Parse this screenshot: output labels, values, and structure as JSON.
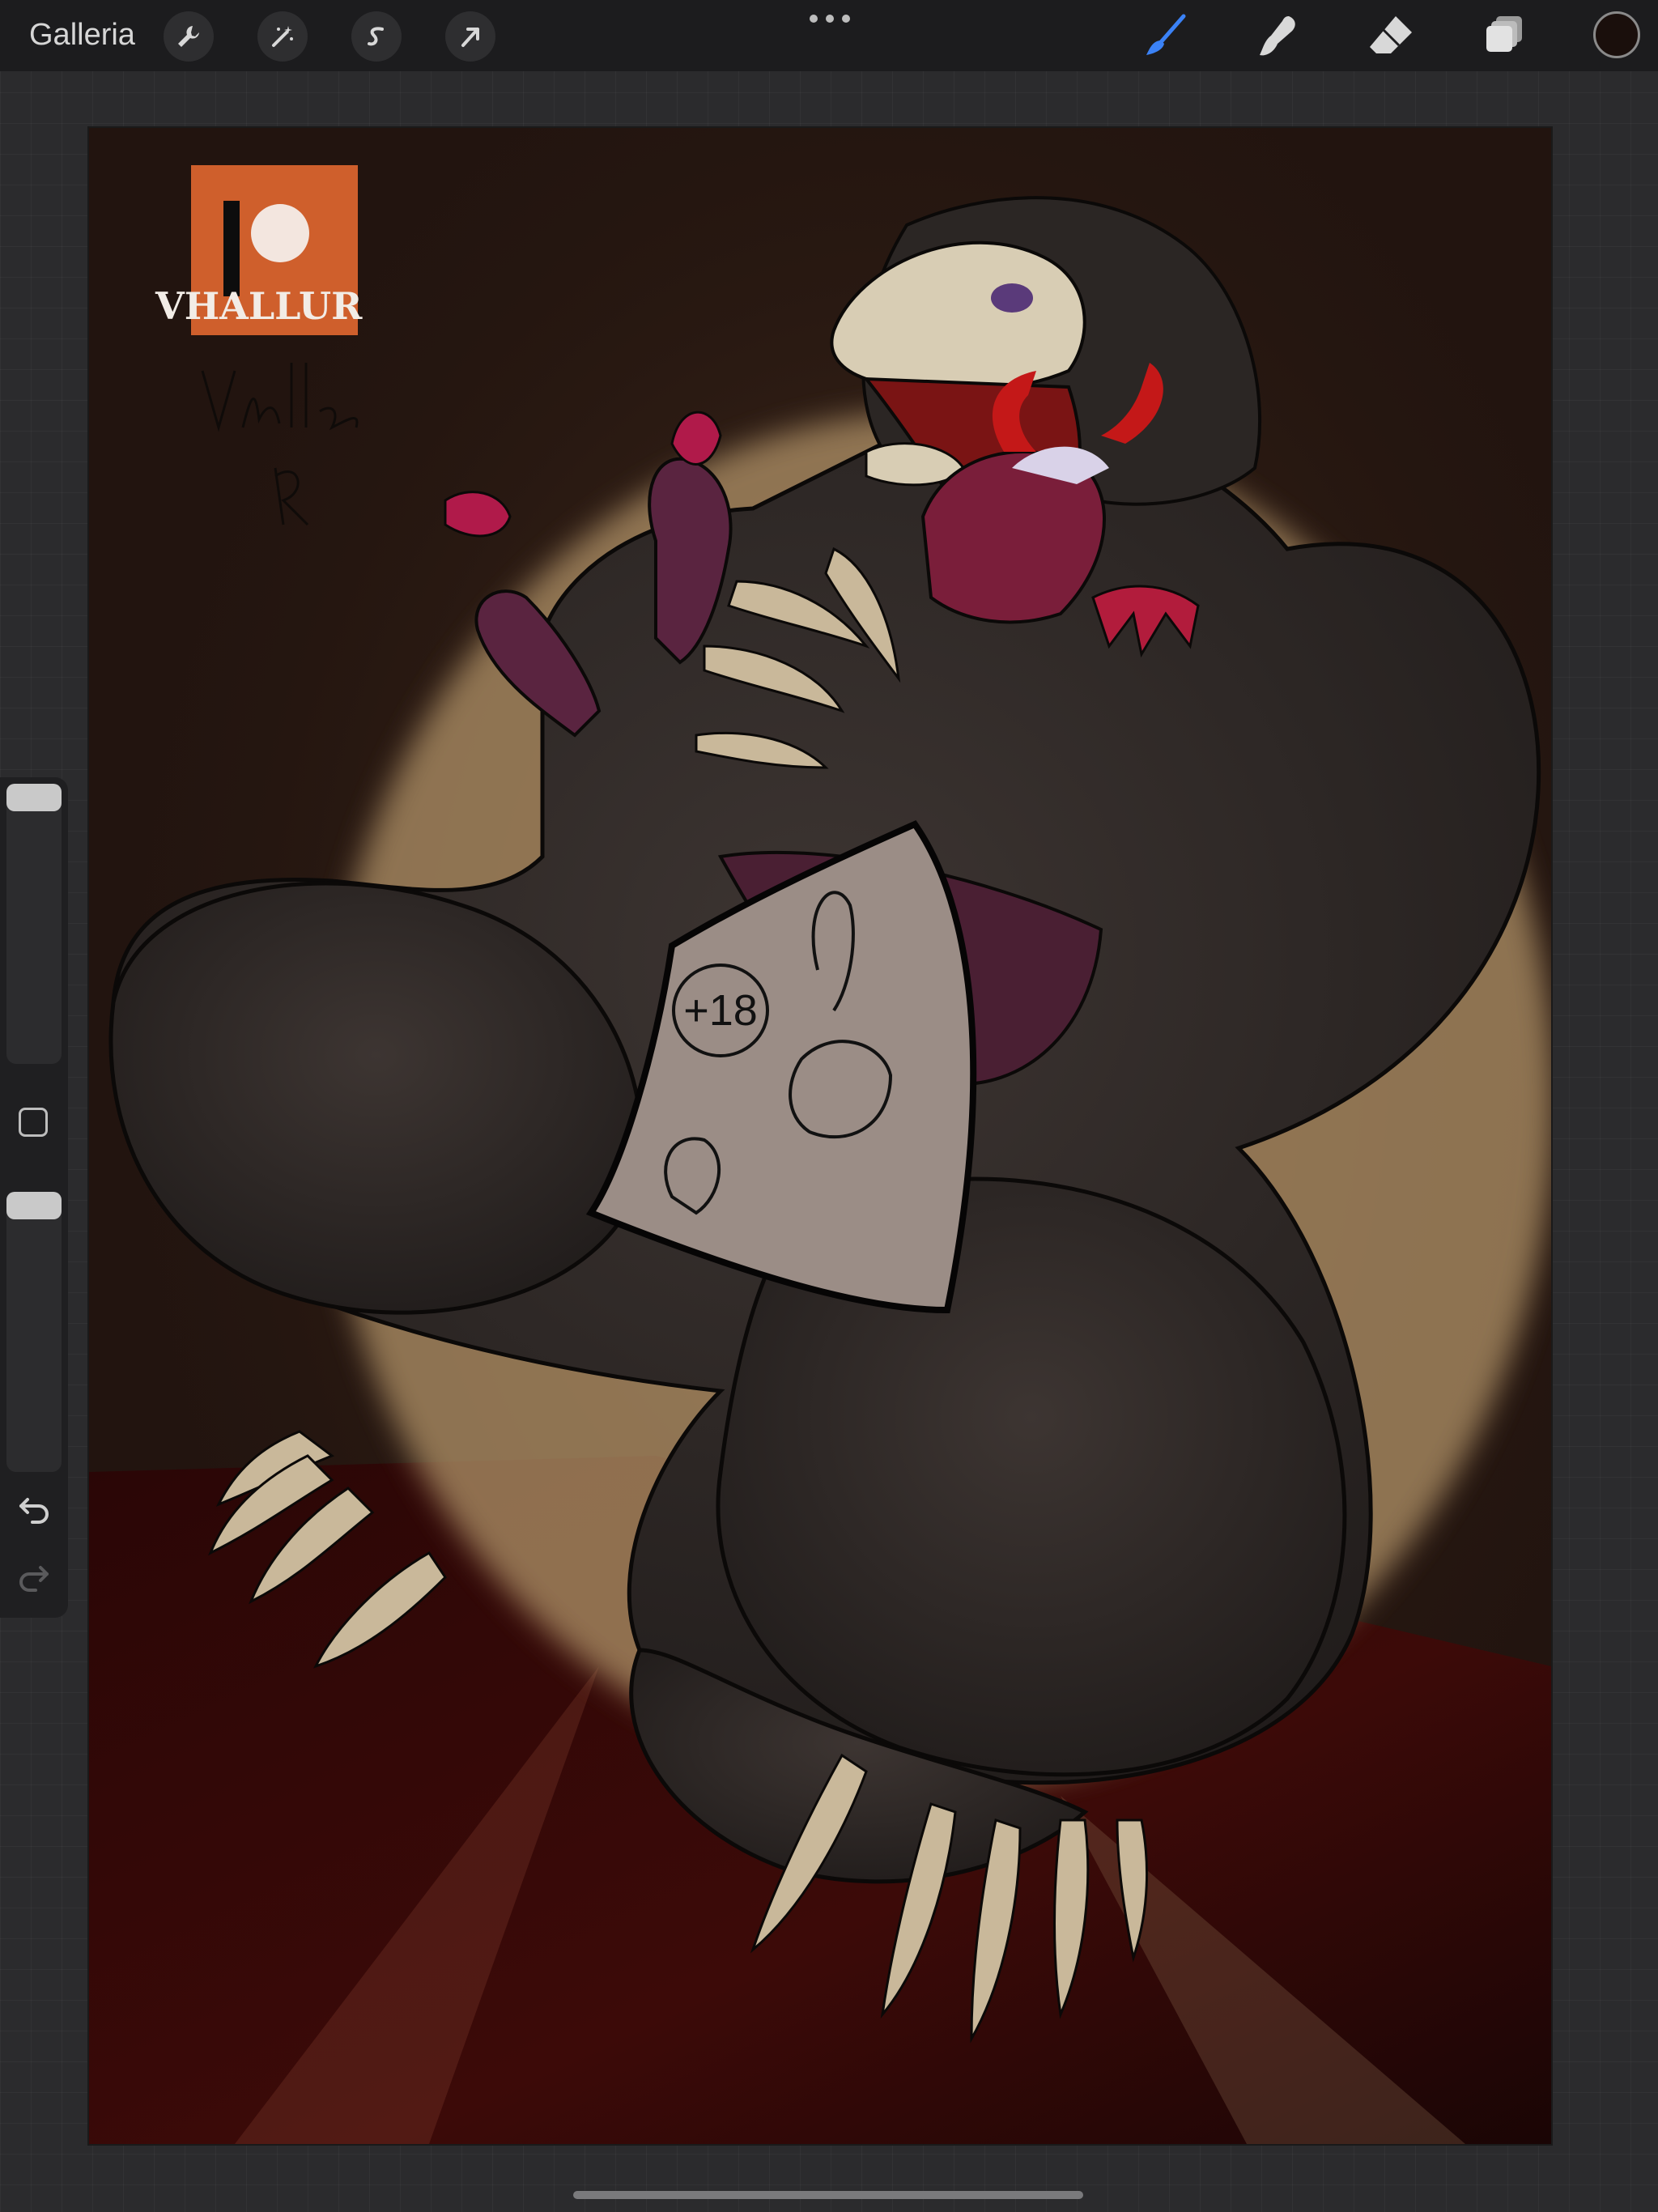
{
  "topbar": {
    "gallery_label": "Galleria",
    "left_tools": [
      "wrench-icon",
      "magic-wand-icon",
      "selection-s-icon",
      "arrow-transform-icon"
    ],
    "right_tools": [
      "brush-icon",
      "smudge-icon",
      "eraser-icon",
      "layers-icon"
    ],
    "active_tool": "brush-icon",
    "accent_color": "#3b82f6",
    "current_color": "#1a0f0c"
  },
  "sidebar": {
    "brush_size_level": 0.0,
    "opacity_level": 0.0,
    "icons": [
      "modify-square-icon",
      "undo-icon",
      "redo-icon"
    ]
  },
  "canvas": {
    "logo_text": "VHALLUR",
    "logo_color": "#cf5f2c",
    "badge_text": "+18"
  }
}
